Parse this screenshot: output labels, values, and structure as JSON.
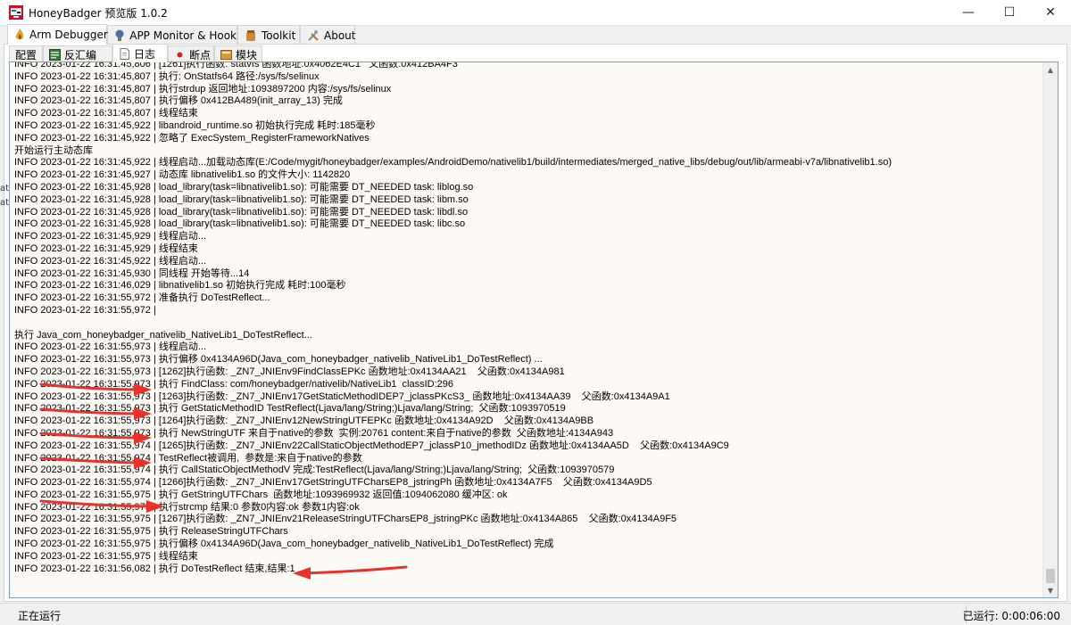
{
  "window": {
    "title": "HoneyBadger 预览版 1.0.2",
    "controls": {
      "minimize": "—",
      "maximize": "☐",
      "close": "✕"
    }
  },
  "main_tabs": [
    {
      "label": "Arm Debugger",
      "icon": "flame-icon"
    },
    {
      "label": "APP Monitor & Hook",
      "icon": "light-bulb-icon"
    },
    {
      "label": "Toolkit",
      "icon": "toolkit-jar-icon"
    },
    {
      "label": "About",
      "icon": "tools-icon"
    }
  ],
  "sub_tabs": [
    {
      "label": "配置",
      "icon": ""
    },
    {
      "label": "反汇编",
      "icon": "disassembly-icon"
    },
    {
      "label": "日志",
      "icon": "log-icon"
    },
    {
      "label": "断点",
      "icon": "breakpoint-dot-icon"
    },
    {
      "label": "模块",
      "icon": "module-icon"
    }
  ],
  "log_lines": [
    "INFO 2023-01-22 16:31:45,806 | [1261]执行函数: statvfs 函数地址:0x4062E4C1   父函数:0x412BA4F3",
    "INFO 2023-01-22 16:31:45,807 | 执行: OnStatfs64 路径:/sys/fs/selinux",
    "INFO 2023-01-22 16:31:45,807 | 执行strdup 返回地址:1093897200 内容:/sys/fs/selinux",
    "INFO 2023-01-22 16:31:45,807 | 执行偏移 0x412BA489(init_array_13) 完成",
    "INFO 2023-01-22 16:31:45,807 | 线程结束",
    "INFO 2023-01-22 16:31:45,922 | libandroid_runtime.so 初始执行完成 耗时:185毫秒",
    "INFO 2023-01-22 16:31:45,922 | 忽略了 ExecSystem_RegisterFrameworkNatives",
    "开始运行主动态库",
    "INFO 2023-01-22 16:31:45,922 | 线程启动...加载动态库(E:/Code/mygit/honeybadger/examples/AndroidDemo/nativelib1/build/intermediates/merged_native_libs/debug/out/lib/armeabi-v7a/libnativelib1.so)",
    "INFO 2023-01-22 16:31:45,927 | 动态库 libnativelib1.so 的文件大小: 1142820",
    "INFO 2023-01-22 16:31:45,928 | load_library(task=libnativelib1.so): 可能需要 DT_NEEDED task: liblog.so",
    "INFO 2023-01-22 16:31:45,928 | load_library(task=libnativelib1.so): 可能需要 DT_NEEDED task: libm.so",
    "INFO 2023-01-22 16:31:45,928 | load_library(task=libnativelib1.so): 可能需要 DT_NEEDED task: libdl.so",
    "INFO 2023-01-22 16:31:45,928 | load_library(task=libnativelib1.so): 可能需要 DT_NEEDED task: libc.so",
    "INFO 2023-01-22 16:31:45,929 | 线程启动...",
    "INFO 2023-01-22 16:31:45,929 | 线程结束",
    "INFO 2023-01-22 16:31:45,922 | 线程启动...",
    "INFO 2023-01-22 16:31:45,930 | 同线程 开始等待...14",
    "INFO 2023-01-22 16:31:46,029 | libnativelib1.so 初始执行完成 耗时:100毫秒",
    "INFO 2023-01-22 16:31:55,972 | 准备执行 DoTestReflect...",
    "INFO 2023-01-22 16:31:55,972 |",
    "",
    "执行 Java_com_honeybadger_nativelib_NativeLib1_DoTestReflect...",
    "INFO 2023-01-22 16:31:55,973 | 线程启动...",
    "INFO 2023-01-22 16:31:55,973 | 执行偏移 0x4134A96D(Java_com_honeybadger_nativelib_NativeLib1_DoTestReflect) ...",
    "INFO 2023-01-22 16:31:55,973 | [1262]执行函数: _ZN7_JNIEnv9FindClassEPKc 函数地址:0x4134AA21    父函数:0x4134A981",
    "INFO 2023-01-22 16:31:55,973 | 执行 FindClass: com/honeybadger/nativelib/NativeLib1  classID:296",
    "INFO 2023-01-22 16:31:55,973 | [1263]执行函数: _ZN7_JNIEnv17GetStaticMethodIDEP7_jclassPKcS3_ 函数地址:0x4134AA39    父函数:0x4134A9A1",
    "INFO 2023-01-22 16:31:55,973 | 执行 GetStaticMethodID TestReflect(Ljava/lang/String;)Ljava/lang/String;  父函数:1093970519",
    "INFO 2023-01-22 16:31:55,973 | [1264]执行函数: _ZN7_JNIEnv12NewStringUTFEPKc 函数地址:0x4134A92D    父函数:0x4134A9BB",
    "INFO 2023-01-22 16:31:55,973 | 执行 NewStringUTF 来自于native的参数  实例:20761 content:来自于native的参数  父函数地址:4134A943",
    "INFO 2023-01-22 16:31:55,974 | [1265]执行函数: _ZN7_JNIEnv22CallStaticObjectMethodEP7_jclassP10_jmethodIDz 函数地址:0x4134AA5D    父函数:0x4134A9C9",
    "INFO 2023-01-22 16:31:55,974 | TestReflect被调用,  参数是:来自于native的参数",
    "INFO 2023-01-22 16:31:55,974 | 执行 CallStaticObjectMethodV 完成:TestReflect(Ljava/lang/String;)Ljava/lang/String;  父函数:1093970579",
    "INFO 2023-01-22 16:31:55,974 | [1266]执行函数: _ZN7_JNIEnv17GetStringUTFCharsEP8_jstringPh 函数地址:0x4134A7F5    父函数:0x4134A9D5",
    "INFO 2023-01-22 16:31:55,975 | 执行 GetStringUTFChars  函数地址:1093969932 返回值:1094062080 缓冲区: ok",
    "INFO 2023-01-22 16:31:55,975 | 执行strcmp 结果:0 参数0内容:ok 参数1内容:ok",
    "INFO 2023-01-22 16:31:55,975 | [1267]执行函数: _ZN7_JNIEnv21ReleaseStringUTFCharsEP8_jstringPKc 函数地址:0x4134A865    父函数:0x4134A9F5",
    "INFO 2023-01-22 16:31:55,975 | 执行 ReleaseStringUTFChars",
    "INFO 2023-01-22 16:31:55,975 | 执行偏移 0x4134A96D(Java_com_honeybadger_nativelib_NativeLib1_DoTestReflect) 完成",
    "INFO 2023-01-22 16:31:55,975 | 线程结束",
    "INFO 2023-01-22 16:31:56,082 | 执行 DoTestReflect 结束,结果:1"
  ],
  "status": {
    "left": "正在运行",
    "right": "已运行: 0:00:06:00"
  },
  "edge_fragments": [
    "at",
    "at"
  ],
  "colors": {
    "annotation_arrow": "#e8322b",
    "log_background": "#fdfaf5",
    "log_border": "#7a9bd1"
  }
}
